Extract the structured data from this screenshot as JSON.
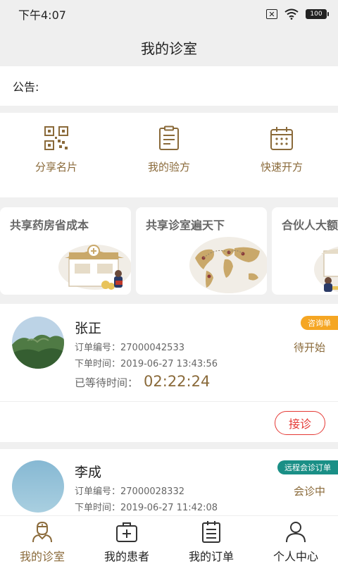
{
  "status_bar": {
    "time": "下午4:07",
    "battery": "100"
  },
  "header": {
    "title": "我的诊室"
  },
  "notice": {
    "label": "公告:"
  },
  "shortcuts": [
    {
      "label": "分享名片",
      "icon": "qr-code-icon"
    },
    {
      "label": "我的验方",
      "icon": "document-icon"
    },
    {
      "label": "快速开方",
      "icon": "calendar-icon"
    }
  ],
  "banners": [
    {
      "title": "共享药房省成本"
    },
    {
      "title": "共享诊室遍天下"
    },
    {
      "title": "合伙人大额"
    }
  ],
  "orders": [
    {
      "name": "张正",
      "order_no": "订单编号：27000042533",
      "order_time": "下单时间：2019-06-27 13:43:56",
      "wait_label": "已等待时间：",
      "wait_value": "02:22:24",
      "tag": "咨询单",
      "tag_color": "#f5a623",
      "state": "待开始",
      "action": "接诊"
    },
    {
      "name": "李成",
      "order_no": "订单编号：27000028332",
      "order_time": "下单时间：2019-06-27 11:42:08",
      "tag": "远程会诊订单",
      "tag_color": "#1a8f86",
      "state": "会诊中"
    }
  ],
  "tabs": [
    {
      "label": "我的诊室",
      "icon": "doctor-icon",
      "active": true
    },
    {
      "label": "我的患者",
      "icon": "medical-kit-icon",
      "active": false
    },
    {
      "label": "我的订单",
      "icon": "order-list-icon",
      "active": false
    },
    {
      "label": "个人中心",
      "icon": "person-icon",
      "active": false
    }
  ],
  "colors": {
    "accent": "#8a6a3a",
    "danger": "#e53935",
    "background": "#f0f0f0"
  }
}
